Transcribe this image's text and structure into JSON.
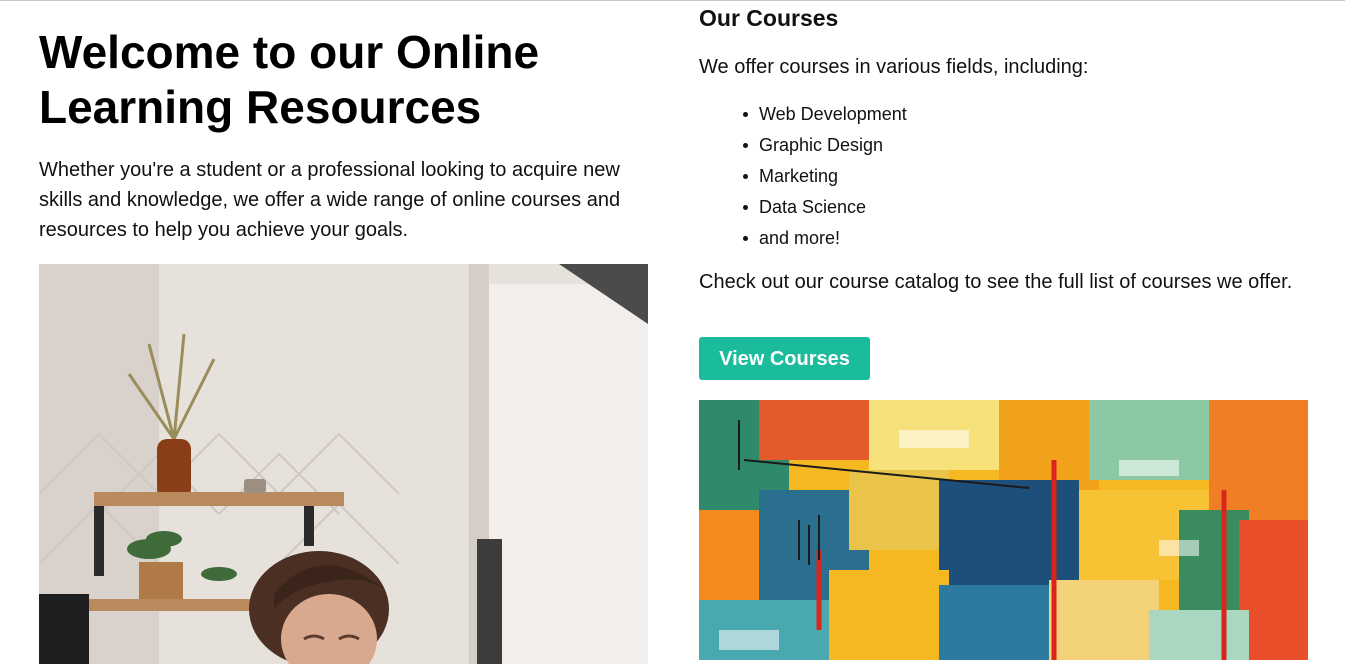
{
  "hero": {
    "title": "Welcome to our Online Learning Resources",
    "text": "Whether you're a student or a professional looking to acquire new skills and knowledge, we offer a wide range of online courses and resources to help you achieve your goals.",
    "image_icon": "photo-woman-at-desk"
  },
  "courses": {
    "title": "Our Courses",
    "intro": "We offer courses in various fields, including:",
    "items": [
      "Web Development",
      "Graphic Design",
      "Marketing",
      "Data Science",
      "and more!"
    ],
    "catalog_text": "Check out our course catalog to see the full list of courses we offer.",
    "button_label": "View Courses",
    "button_color": "#1abc9c",
    "image_icon": "photo-abstract-painting"
  }
}
